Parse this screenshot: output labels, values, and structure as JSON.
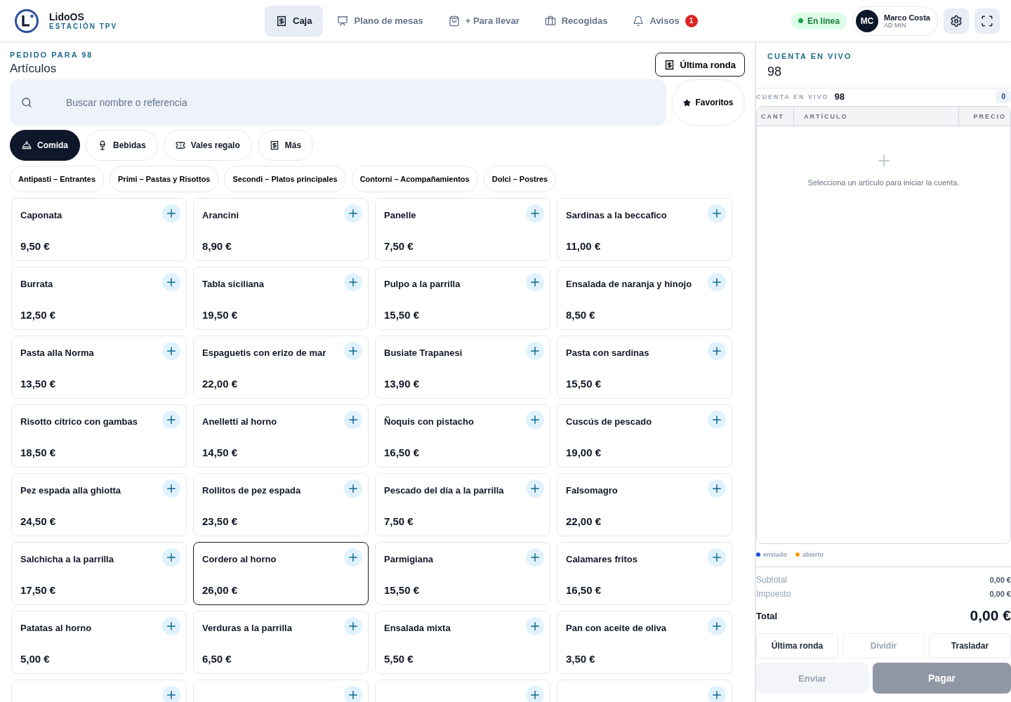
{
  "brand": {
    "name": "LidoOS",
    "subtitle": "ESTACIÓN TPV"
  },
  "nav": [
    {
      "label": "Caja",
      "selected": true
    },
    {
      "label": "Plano de mesas",
      "selected": false
    },
    {
      "label": "+ Para llevar",
      "selected": false
    },
    {
      "label": "Recogidas",
      "selected": false
    },
    {
      "label": "Avisos",
      "selected": false,
      "badge": "1"
    }
  ],
  "status": {
    "label": "En línea",
    "color": "#16a34a"
  },
  "user": {
    "initials": "MC",
    "name": "Marco Costa",
    "role": "AD MIN"
  },
  "order": {
    "eyebrow": "PEDIDO PARA 98",
    "title": "Artículos",
    "last_round_button": "Última ronda",
    "search_placeholder": "Buscar nombre o referencia",
    "favorites_button": "Favoritos"
  },
  "categories": [
    {
      "label": "Comida",
      "selected": true
    },
    {
      "label": "Bebidas",
      "selected": false
    },
    {
      "label": "Vales regalo",
      "selected": false
    },
    {
      "label": "Más",
      "selected": false
    }
  ],
  "subcategories": [
    {
      "label": "Antipasti – Entrantes"
    },
    {
      "label": "Primi – Pastas y Risottos"
    },
    {
      "label": "Secondi – Platos principales"
    },
    {
      "label": "Contorni – Acompañamientos"
    },
    {
      "label": "Dolci – Postres"
    }
  ],
  "items": [
    {
      "kind": "item",
      "name": "Caponata",
      "price": "9,50 €",
      "selected": false
    },
    {
      "kind": "item",
      "name": "Arancini",
      "price": "8,90 €",
      "selected": false
    },
    {
      "kind": "item",
      "name": "Panelle",
      "price": "7,50 €",
      "selected": false
    },
    {
      "kind": "item",
      "name": "Sardinas a la beccafico",
      "price": "11,00 €",
      "selected": false
    },
    {
      "kind": "item",
      "name": "Burrata",
      "price": "12,50 €",
      "selected": false
    },
    {
      "kind": "item",
      "name": "Tabla siciliana",
      "price": "19,50 €",
      "selected": false
    },
    {
      "kind": "item",
      "name": "Pulpo a la parrilla",
      "price": "15,50 €",
      "selected": false
    },
    {
      "kind": "item",
      "name": "Ensalada de naranja y hinojo",
      "price": "8,50 €",
      "selected": false
    },
    {
      "kind": "item",
      "name": "Pasta alla Norma",
      "price": "13,50 €",
      "selected": false
    },
    {
      "kind": "item",
      "name": "Espaguetis con erizo de mar",
      "price": "22,00 €",
      "selected": false
    },
    {
      "kind": "item",
      "name": "Busiate Trapanesi",
      "price": "13,90 €",
      "selected": false
    },
    {
      "kind": "item",
      "name": "Pasta con sardinas",
      "price": "15,50 €",
      "selected": false
    },
    {
      "kind": "item",
      "name": "Risotto cítrico con gambas",
      "price": "18,50 €",
      "selected": false
    },
    {
      "kind": "item",
      "name": "Anelletti al horno",
      "price": "14,50 €",
      "selected": false
    },
    {
      "kind": "item",
      "name": "Ñoquis con pistacho",
      "price": "16,50 €",
      "selected": false
    },
    {
      "kind": "item",
      "name": "Cuscús de pescado",
      "price": "19,00 €",
      "selected": false
    },
    {
      "kind": "item",
      "name": "Pez espada alla ghiotta",
      "price": "24,50 €",
      "selected": false
    },
    {
      "kind": "item",
      "name": "Rollitos de pez espada",
      "price": "23,50 €",
      "selected": false
    },
    {
      "kind": "item",
      "name": "Pescado del día a la parrilla",
      "price": "7,50 €",
      "selected": false
    },
    {
      "kind": "item",
      "name": "Falsomagro",
      "price": "22,00 €",
      "selected": false
    },
    {
      "kind": "item",
      "name": "Salchicha a la parrilla",
      "price": "17,50 €",
      "selected": false
    },
    {
      "kind": "item",
      "name": "Cordero al horno",
      "price": "26,00 €",
      "selected": true
    },
    {
      "kind": "item",
      "name": "Parmigiana",
      "price": "15,50 €",
      "selected": false
    },
    {
      "kind": "item",
      "name": "Calamares fritos",
      "price": "16,50 €",
      "selected": false
    },
    {
      "kind": "item",
      "name": "Patatas al horno",
      "price": "5,00 €",
      "selected": false
    },
    {
      "kind": "item",
      "name": "Verduras a la parrilla",
      "price": "6,50 €",
      "selected": false
    },
    {
      "kind": "item",
      "name": "Ensalada mixta",
      "price": "5,50 €",
      "selected": false
    },
    {
      "kind": "item",
      "name": "Pan con aceite de oliva",
      "price": "3,50 €",
      "selected": false
    },
    {
      "kind": "cut"
    },
    {
      "kind": "cut"
    },
    {
      "kind": "cut"
    },
    {
      "kind": "cut"
    }
  ],
  "bill": {
    "eyebrow": "CUENTA EN VIVO",
    "number": "98",
    "bar_label": "CUENTA EN VIVO",
    "bar_number": "98",
    "count": "0",
    "columns": [
      "CANT",
      "ARTÍCULO",
      "PRECIO"
    ],
    "empty_text": "Selecciona un artículo para iniciar la cuenta.",
    "legend": [
      {
        "label": "enviado",
        "color": "#1d4ed8"
      },
      {
        "label": "abierto",
        "color": "#f59e0b"
      }
    ],
    "totals": [
      {
        "label": "Subtotal",
        "value": "0,00 €"
      },
      {
        "label": "Impuesto",
        "value": "0,00 €"
      }
    ],
    "total": {
      "label": "Total",
      "value": "0,00 €"
    },
    "actions": [
      {
        "label": "Última ronda",
        "disabled": false
      },
      {
        "label": "Dividir",
        "disabled": true
      },
      {
        "label": "Trasladar",
        "disabled": false
      }
    ],
    "send": {
      "label": "Enviar",
      "disabled": true
    },
    "pay": {
      "label": "Pagar",
      "disabled": false
    }
  }
}
